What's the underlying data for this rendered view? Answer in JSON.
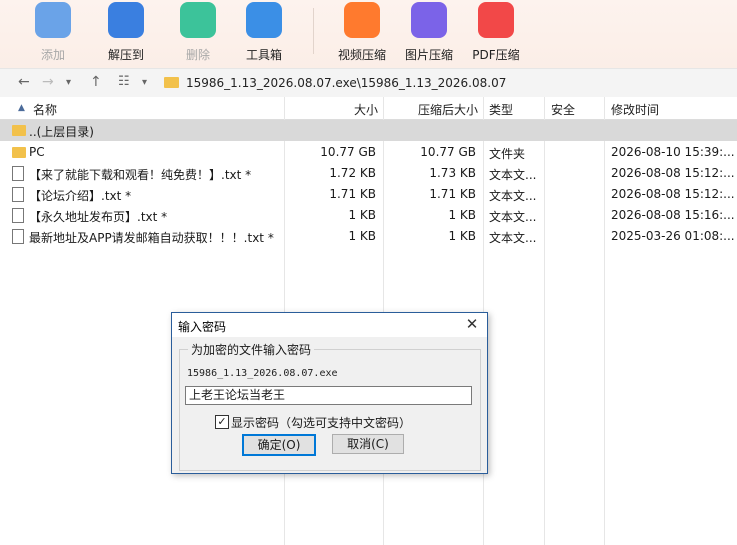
{
  "toolbar": {
    "add": {
      "label": "添加",
      "disabled": true,
      "color": "#4b8bd6"
    },
    "extract": {
      "label": "解压到",
      "color": "#3a7fe0"
    },
    "delete": {
      "label": "删除",
      "disabled": true,
      "color": "#3cc39a"
    },
    "tools": {
      "label": "工具箱",
      "color": "#3b8fe6"
    },
    "video": {
      "label": "视频压缩",
      "color": "#ff7a2e"
    },
    "image": {
      "label": "图片压缩",
      "color": "#7b63e8"
    },
    "pdf": {
      "label": "PDF压缩",
      "color": "#f24848"
    }
  },
  "address": {
    "path": "15986_1.13_2026.08.07.exe\\15986_1.13_2026.08.07"
  },
  "columns": {
    "name": "名称",
    "size": "大小",
    "packed": "压缩后大小",
    "type": "类型",
    "security": "安全",
    "modified": "修改时间"
  },
  "rows": [
    {
      "name": "..(上层目录)",
      "size": "",
      "packed": "",
      "type": "",
      "modified": ""
    },
    {
      "name": "PC",
      "size": "10.77 GB",
      "packed": "10.77 GB",
      "type": "文件夹",
      "modified": "2026-08-10 15:39:..."
    },
    {
      "name": "【来了就能下载和观看！纯免费！】.txt *",
      "size": "1.72 KB",
      "packed": "1.73 KB",
      "type": "文本文...",
      "modified": "2026-08-08 15:12:..."
    },
    {
      "name": "【论坛介绍】.txt *",
      "size": "1.71 KB",
      "packed": "1.71 KB",
      "type": "文本文...",
      "modified": "2026-08-08 15:12:..."
    },
    {
      "name": "【永久地址发布页】.txt *",
      "size": "1 KB",
      "packed": "1 KB",
      "type": "文本文...",
      "modified": "2026-08-08 15:16:..."
    },
    {
      "name": "最新地址及APP请发邮箱自动获取！！！.txt *",
      "size": "1 KB",
      "packed": "1 KB",
      "type": "文本文...",
      "modified": "2025-03-26 01:08:..."
    }
  ],
  "dialog": {
    "title": "输入密码",
    "group_title": "为加密的文件输入密码",
    "filename": "15986_1.13_2026.08.07.exe",
    "password": "上老王论坛当老王",
    "show_password_label": "显示密码（勾选可支持中文密码）",
    "show_password_checked": true,
    "ok_label": "确定(O)",
    "cancel_label": "取消(C)"
  }
}
